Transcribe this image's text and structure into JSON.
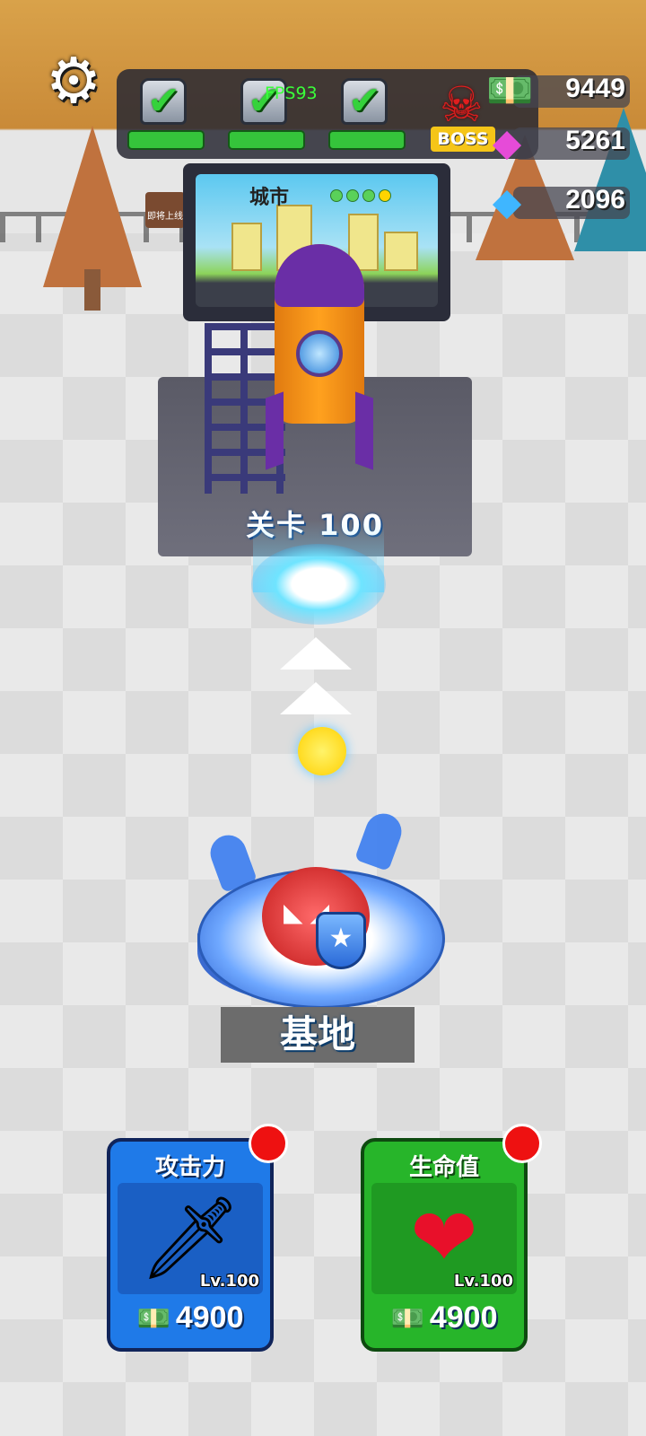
{
  "hud": {
    "fps": "FPS93",
    "boss_tag": "BOSS",
    "chests": [
      {
        "state": "completed"
      },
      {
        "state": "completed"
      },
      {
        "state": "completed"
      }
    ],
    "currencies": {
      "cash": "9449",
      "pink_gem": "5261",
      "blue_crystal": "2096"
    }
  },
  "world": {
    "board_title": "城市",
    "level_label": "关卡 100",
    "base_label": "基地",
    "sign_text": "即将上线"
  },
  "upgrades": [
    {
      "title": "攻击力",
      "level": "Lv.100",
      "cost": "4900",
      "icon": "sword-icon",
      "color": "#1f7ae8"
    },
    {
      "title": "生命值",
      "level": "Lv.100",
      "cost": "4900",
      "icon": "heart-icon",
      "color": "#27b52a"
    }
  ],
  "colors": {
    "accent_red": "#ee1111",
    "attack_blue": "#1f7ae8",
    "health_green": "#27b52a"
  }
}
